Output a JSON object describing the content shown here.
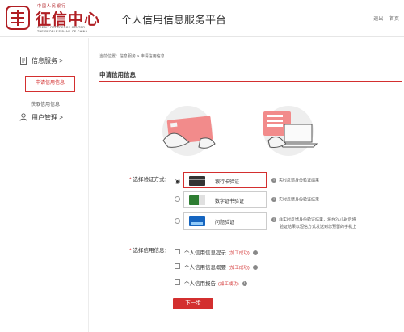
{
  "header": {
    "logo_top": "中國人民银行",
    "logo_cn": "征信中心",
    "logo_en_line1": "CREDIT REFERENCE CENTER",
    "logo_en_line2": "THE PEOPLE'S BANK OF CHINA",
    "site_title": "个人信用信息服务平台",
    "links": [
      "退出",
      "首页"
    ]
  },
  "sidebar": {
    "groups": [
      {
        "label": "信息服务 >",
        "icon": "document-icon",
        "items": [
          {
            "label": "申请信用信息",
            "active": true
          },
          {
            "label": "获取信用信息",
            "active": false
          }
        ]
      },
      {
        "label": "用户管理 >",
        "icon": "user-icon",
        "items": []
      }
    ]
  },
  "main": {
    "breadcrumb": "当前位置：信息服务 > 申请信用信息",
    "title": "申请信用信息",
    "verify": {
      "label": "选择验证方式：",
      "options": [
        {
          "label": "银行卡验证",
          "icon": "bank-card-icon",
          "hint": "实时反馈身份验证结果",
          "selected": true
        },
        {
          "label": "数字证书验证",
          "icon": "certificate-icon",
          "hint": "实时反馈身份验证结果",
          "selected": false
        },
        {
          "label": "问题验证",
          "icon": "question-icon",
          "hint": "非实时反馈身份验证结果，将在24小时后将",
          "hint2": "验证结果以短信方式发送到您预留的手机上",
          "selected": false
        }
      ]
    },
    "info": {
      "label": "选择信用信息：",
      "items": [
        {
          "label": "个人信用信息提示",
          "status": "(加工成功)"
        },
        {
          "label": "个人信用信息概要",
          "status": "(加工成功)"
        },
        {
          "label": "个人信用报告",
          "status": "(加工成功)"
        }
      ]
    },
    "next_label": "下一步"
  },
  "colors": {
    "accent": "#d32f2f",
    "brand": "#b01e23"
  }
}
